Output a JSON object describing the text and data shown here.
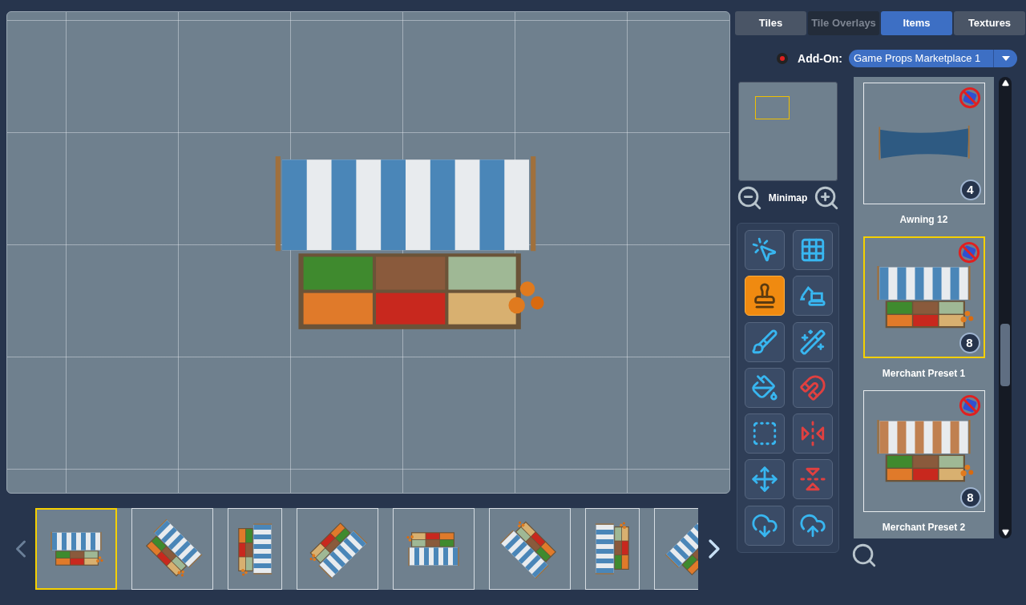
{
  "tabs": [
    {
      "label": "Tiles",
      "selected": false,
      "disabled": false
    },
    {
      "label": "Tile Overlays",
      "selected": false,
      "disabled": true
    },
    {
      "label": "Items",
      "selected": true,
      "disabled": false
    },
    {
      "label": "Textures",
      "selected": false,
      "disabled": false
    }
  ],
  "addon": {
    "label": "Add-On:",
    "value": "Game Props Marketplace 1"
  },
  "minimap": {
    "label": "Minimap"
  },
  "tools": [
    {
      "kind": "select",
      "selected": false
    },
    {
      "kind": "grid",
      "selected": false
    },
    {
      "kind": "stamp",
      "selected": true
    },
    {
      "kind": "excavator",
      "selected": false
    },
    {
      "kind": "brush",
      "selected": false
    },
    {
      "kind": "wand",
      "selected": false
    },
    {
      "kind": "bucket",
      "selected": false
    },
    {
      "kind": "snap",
      "selected": false
    },
    {
      "kind": "marquee",
      "selected": false
    },
    {
      "kind": "flip-h",
      "selected": false
    },
    {
      "kind": "move",
      "selected": false
    },
    {
      "kind": "flip-v",
      "selected": false
    },
    {
      "kind": "import",
      "selected": false
    },
    {
      "kind": "export",
      "selected": false
    }
  ],
  "items": [
    {
      "kind": "awning",
      "name": "Awning 12",
      "count": "4",
      "selected": false
    },
    {
      "kind": "stall-blue",
      "name": "Merchant Preset 1",
      "count": "8",
      "selected": true
    },
    {
      "kind": "stall-orange",
      "name": "Merchant Preset 2",
      "count": "8",
      "selected": false
    }
  ],
  "variations": [
    {
      "kind": "n",
      "selected": true
    },
    {
      "kind": "ne",
      "selected": false
    },
    {
      "kind": "e",
      "selected": false
    },
    {
      "kind": "se",
      "selected": false
    },
    {
      "kind": "s",
      "selected": false
    },
    {
      "kind": "sw",
      "selected": false
    },
    {
      "kind": "w",
      "selected": false
    },
    {
      "kind": "nw",
      "selected": false
    }
  ]
}
